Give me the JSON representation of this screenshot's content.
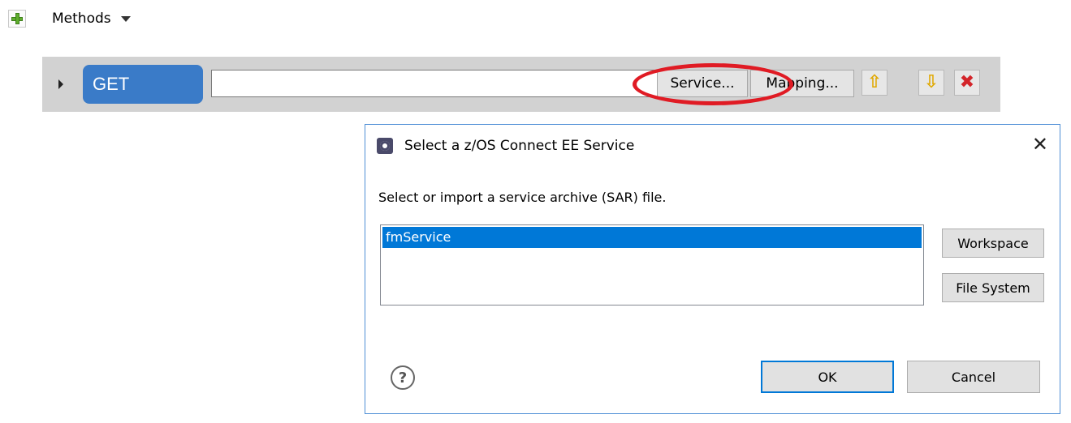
{
  "methods_bar": {
    "label": "Methods"
  },
  "method_row": {
    "verb": "GET",
    "path_value": "",
    "service_button": "Service...",
    "mapping_button": "Mapping..."
  },
  "dialog": {
    "title": "Select a z/OS Connect EE Service",
    "message": "Select or import a service archive (SAR) file.",
    "services": [
      "fmService"
    ],
    "selected": "fmService",
    "workspace_button": "Workspace",
    "file_system_button": "File System",
    "ok_button": "OK",
    "cancel_button": "Cancel",
    "help_glyph": "?"
  },
  "icons": {
    "add": "add-icon",
    "dropdown": "chevron-down-icon",
    "expand": "expand-arrow-icon",
    "move_up": "arrow-up-icon",
    "move_down": "arrow-down-icon",
    "delete": "delete-icon",
    "close": "close-icon",
    "help": "help-icon",
    "dialog_title": "gear-icon"
  },
  "colors": {
    "verb_bg": "#3a7bc8",
    "selection_bg": "#0078d7",
    "highlight_ring": "#e01b24",
    "row_bg": "#d2d2d2"
  }
}
